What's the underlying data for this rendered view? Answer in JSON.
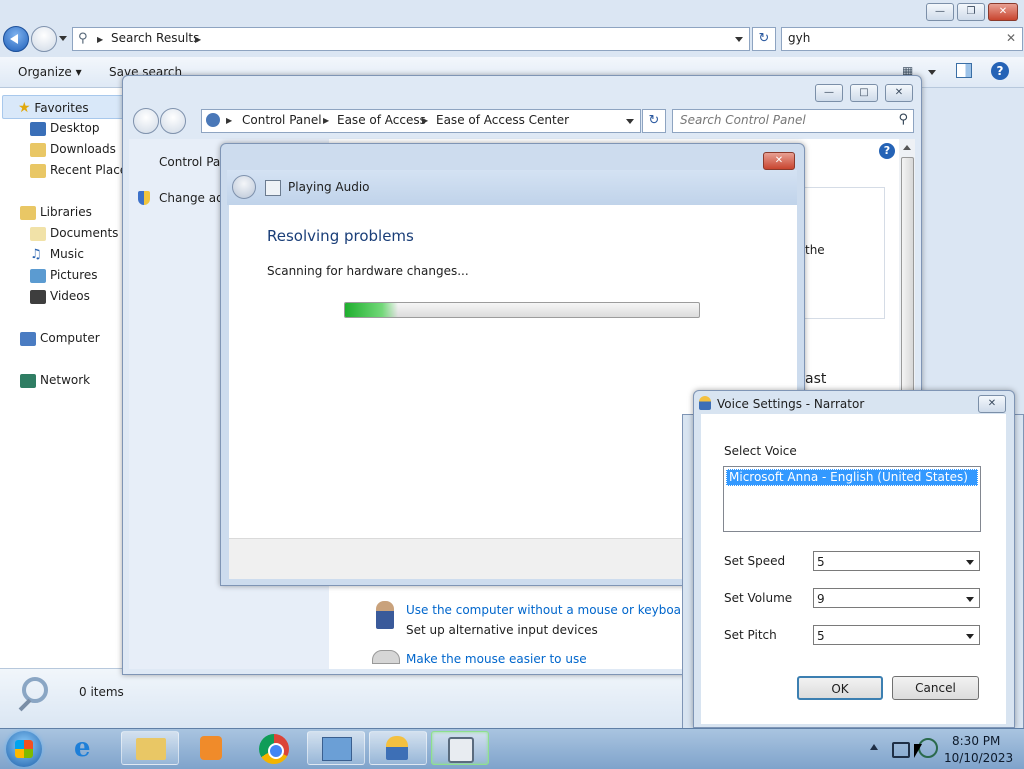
{
  "explorer": {
    "address": "Search Results",
    "search_value": "gyh",
    "toolbar": {
      "organize": "Organize",
      "save_search": "Save search"
    },
    "sidebar": {
      "favorites": "Favorites",
      "desktop": "Desktop",
      "downloads": "Downloads",
      "recent_places": "Recent Places",
      "libraries": "Libraries",
      "documents": "Documents",
      "music": "Music",
      "pictures": "Pictures",
      "videos": "Videos",
      "computer": "Computer",
      "network": "Network"
    },
    "status": "0 items"
  },
  "control_panel": {
    "crumbs": [
      "Control Panel",
      "Ease of Access",
      "Ease of Access Center"
    ],
    "search_placeholder": "Search Control Panel",
    "left_links": [
      "Control Panel",
      "Change adr"
    ],
    "partial_text_1": "the",
    "partial_text_2": "ast",
    "links": [
      {
        "title": "Use the computer without a mouse or keyboard",
        "desc": "Set up alternative input devices"
      },
      {
        "title": "Make the mouse easier to use"
      }
    ]
  },
  "troubleshooter": {
    "title": "Playing Audio",
    "heading": "Resolving problems",
    "status": "Scanning for hardware changes...",
    "progress": 0.15
  },
  "narrator": {
    "title": "Voice Settings - Narrator",
    "select_voice_label": "Select Voice",
    "voice_selected": "Microsoft Anna - English (United States)",
    "speed_label": "Set Speed",
    "speed_value": "5",
    "volume_label": "Set Volume",
    "volume_value": "9",
    "pitch_label": "Set Pitch",
    "pitch_value": "5",
    "ok": "OK",
    "cancel": "Cancel"
  },
  "taskbar": {
    "time": "8:30 PM",
    "date": "10/10/2023"
  },
  "colors": {
    "accent": "#0066cc",
    "selection": "#3399ff",
    "progress": "#3cc84a"
  }
}
